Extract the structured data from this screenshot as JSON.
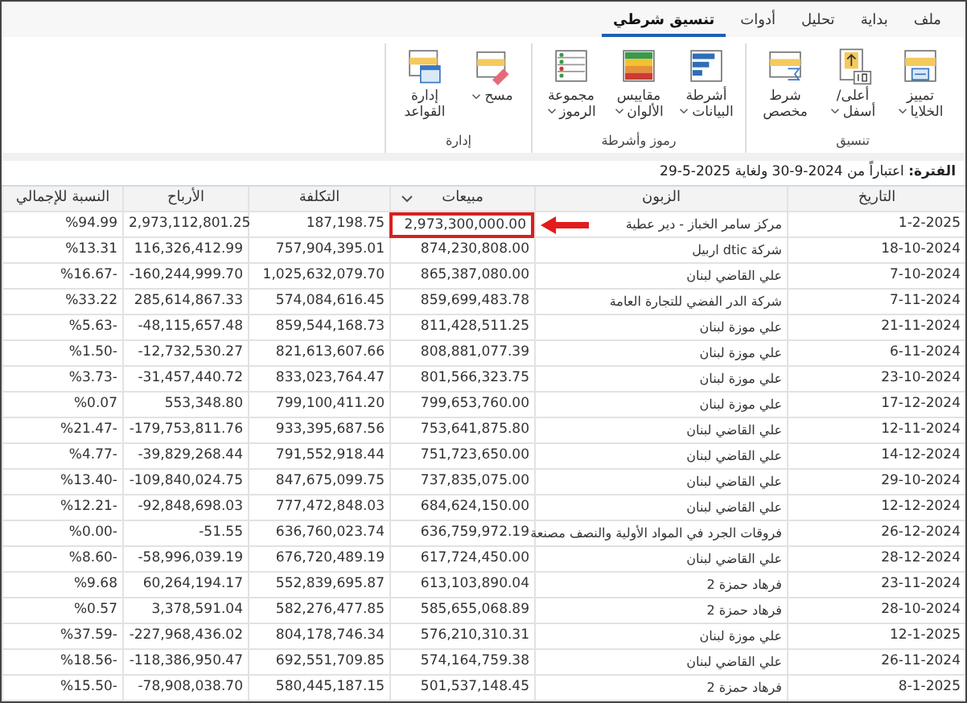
{
  "tabs": [
    {
      "label": "ملف",
      "selected": false
    },
    {
      "label": "بداية",
      "selected": false
    },
    {
      "label": "تحليل",
      "selected": false
    },
    {
      "label": "أدوات",
      "selected": false
    },
    {
      "label": "تنسيق شرطي",
      "selected": true
    }
  ],
  "ribbon_groups": [
    {
      "label": "تنسيق",
      "buttons": [
        {
          "kind": "highlight",
          "label": "تمييز الخلايا",
          "dropdown": true
        },
        {
          "kind": "topbottom",
          "label": "أعلى/أسفل",
          "dropdown": true
        },
        {
          "kind": "custom",
          "label": "شرط مخصص",
          "dropdown": false
        }
      ]
    },
    {
      "label": "رموز وأشرطة",
      "buttons": [
        {
          "kind": "databars",
          "label": "أشرطة البيانات",
          "dropdown": true
        },
        {
          "kind": "colorscales",
          "label": "مقاييس الألوان",
          "dropdown": true
        },
        {
          "kind": "iconset",
          "label": "مجموعة الرموز",
          "dropdown": true
        }
      ]
    },
    {
      "label": "إدارة",
      "buttons": [
        {
          "kind": "clear",
          "label": "مسح",
          "dropdown": true
        },
        {
          "kind": "manage",
          "label": "إدارة القواعد",
          "dropdown": false
        }
      ]
    }
  ],
  "period": "**الفترة:** اعتباراً من 2024-9-30 ولغاية 2025-5-29",
  "table": {
    "columns": [
      "التاريخ",
      "الزبون",
      "مبيعات",
      "التكلفة",
      "الأرباح",
      "النسبة للإجمالي"
    ],
    "rows": [
      {
        "date": "1-2-2025",
        "customer": "مركز سامر الخباز - دير عطية",
        "sales": "2,973,300,000.00",
        "cost": "187,198.75",
        "profit": "2,973,112,801.25",
        "ratio": "%94.99",
        "highlighted": true
      },
      {
        "date": "18-10-2024",
        "customer": "شركة dtic اربيل",
        "sales": "874,230,808.00",
        "cost": "757,904,395.01",
        "profit": "116,326,412.99",
        "ratio": "%13.31",
        "highlighted": false
      },
      {
        "date": "7-10-2024",
        "customer": "علي القاضي لبنان",
        "sales": "865,387,080.00",
        "cost": "1,025,632,079.70",
        "profit": "-160,244,999.70",
        "ratio": "%16.67-",
        "highlighted": false
      },
      {
        "date": "7-11-2024",
        "customer": "شركة الدر الفضي للتجارة العامة",
        "sales": "859,699,483.78",
        "cost": "574,084,616.45",
        "profit": "285,614,867.33",
        "ratio": "%33.22",
        "highlighted": false
      },
      {
        "date": "21-11-2024",
        "customer": "علي موزة لبنان",
        "sales": "811,428,511.25",
        "cost": "859,544,168.73",
        "profit": "-48,115,657.48",
        "ratio": "%5.63-",
        "highlighted": false
      },
      {
        "date": "6-11-2024",
        "customer": "علي موزة لبنان",
        "sales": "808,881,077.39",
        "cost": "821,613,607.66",
        "profit": "-12,732,530.27",
        "ratio": "%1.50-",
        "highlighted": false
      },
      {
        "date": "23-10-2024",
        "customer": "علي موزة لبنان",
        "sales": "801,566,323.75",
        "cost": "833,023,764.47",
        "profit": "-31,457,440.72",
        "ratio": "%3.73-",
        "highlighted": false
      },
      {
        "date": "17-12-2024",
        "customer": "علي موزة لبنان",
        "sales": "799,653,760.00",
        "cost": "799,100,411.20",
        "profit": "553,348.80",
        "ratio": "%0.07",
        "highlighted": false
      },
      {
        "date": "12-11-2024",
        "customer": "علي القاضي لبنان",
        "sales": "753,641,875.80",
        "cost": "933,395,687.56",
        "profit": "-179,753,811.76",
        "ratio": "%21.47-",
        "highlighted": false
      },
      {
        "date": "14-12-2024",
        "customer": "علي القاضي لبنان",
        "sales": "751,723,650.00",
        "cost": "791,552,918.44",
        "profit": "-39,829,268.44",
        "ratio": "%4.77-",
        "highlighted": false
      },
      {
        "date": "29-10-2024",
        "customer": "علي القاضي لبنان",
        "sales": "737,835,075.00",
        "cost": "847,675,099.75",
        "profit": "-109,840,024.75",
        "ratio": "%13.40-",
        "highlighted": false
      },
      {
        "date": "12-12-2024",
        "customer": "علي القاضي لبنان",
        "sales": "684,624,150.00",
        "cost": "777,472,848.03",
        "profit": "-92,848,698.03",
        "ratio": "%12.21-",
        "highlighted": false
      },
      {
        "date": "26-12-2024",
        "customer": "فروقات الجرد في المواد الأولية والنصف مصنعة",
        "sales": "636,759,972.19",
        "cost": "636,760,023.74",
        "profit": "-51.55",
        "ratio": "%0.00-",
        "highlighted": false
      },
      {
        "date": "28-12-2024",
        "customer": "علي القاضي لبنان",
        "sales": "617,724,450.00",
        "cost": "676,720,489.19",
        "profit": "-58,996,039.19",
        "ratio": "%8.60-",
        "highlighted": false
      },
      {
        "date": "23-11-2024",
        "customer": "فرهاد حمزة 2",
        "sales": "613,103,890.04",
        "cost": "552,839,695.87",
        "profit": "60,264,194.17",
        "ratio": "%9.68",
        "highlighted": false
      },
      {
        "date": "28-10-2024",
        "customer": "فرهاد حمزة 2",
        "sales": "585,655,068.89",
        "cost": "582,276,477.85",
        "profit": "3,378,591.04",
        "ratio": "%0.57",
        "highlighted": false
      },
      {
        "date": "12-1-2025",
        "customer": "علي موزة لبنان",
        "sales": "576,210,310.31",
        "cost": "804,178,746.34",
        "profit": "-227,968,436.02",
        "ratio": "%37.59-",
        "highlighted": false
      },
      {
        "date": "26-11-2024",
        "customer": "علي القاضي لبنان",
        "sales": "574,164,759.38",
        "cost": "692,551,709.85",
        "profit": "-118,386,950.47",
        "ratio": "%18.56-",
        "highlighted": false
      },
      {
        "date": "8-1-2025",
        "customer": "فرهاد حمزة 2",
        "sales": "501,537,148.45",
        "cost": "580,445,187.15",
        "profit": "-78,908,038.70",
        "ratio": "%15.50-",
        "highlighted": false
      }
    ]
  }
}
